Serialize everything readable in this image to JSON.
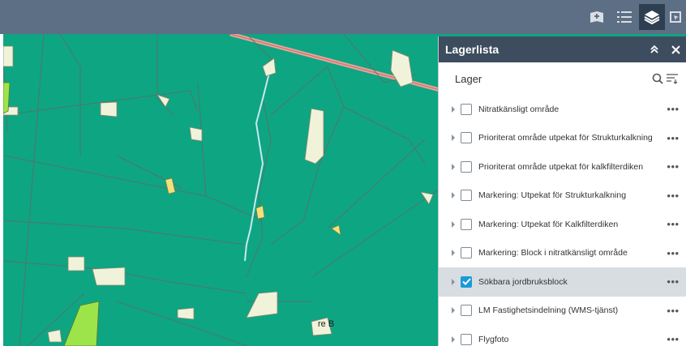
{
  "toolbar": {
    "tools": [
      {
        "name": "map-book-icon",
        "active": false
      },
      {
        "name": "legend-list-icon",
        "active": false
      },
      {
        "name": "layers-icon",
        "active": true
      },
      {
        "name": "map-pointer-icon",
        "active": false
      }
    ]
  },
  "map": {
    "label": "re B"
  },
  "panel": {
    "title": "Lagerlista",
    "collapse_icon": "double-chevron-up-icon",
    "close_icon": "close-icon",
    "section_title": "Lager",
    "search_icon": "search-icon",
    "filter_icon": "sort-filter-icon",
    "layers": [
      {
        "label": "Nitratkänsligt område",
        "checked": false,
        "selected": false
      },
      {
        "label": "Prioriterat område utpekat för Strukturkalkning",
        "checked": false,
        "selected": false
      },
      {
        "label": "Prioriterat område utpekat för kalkfilterdiken",
        "checked": false,
        "selected": false
      },
      {
        "label": "Markering: Utpekat för Strukturkalkning",
        "checked": false,
        "selected": false
      },
      {
        "label": "Markering: Utpekat för Kalkfilterdiken",
        "checked": false,
        "selected": false
      },
      {
        "label": "Markering: Block i nitratkänsligt område",
        "checked": false,
        "selected": false
      },
      {
        "label": "Sökbara jordbruksblock",
        "checked": true,
        "selected": true
      },
      {
        "label": "LM Fastighetsindelning (WMS-tjänst)",
        "checked": false,
        "selected": false
      },
      {
        "label": "Flygfoto",
        "checked": false,
        "selected": false
      }
    ],
    "more_label": "•••"
  },
  "colors": {
    "toolbar": "#5c6f85",
    "panel_header": "#3d4d5f",
    "map_fill": "#0ea582",
    "checkbox_checked": "#1a9ad8"
  }
}
